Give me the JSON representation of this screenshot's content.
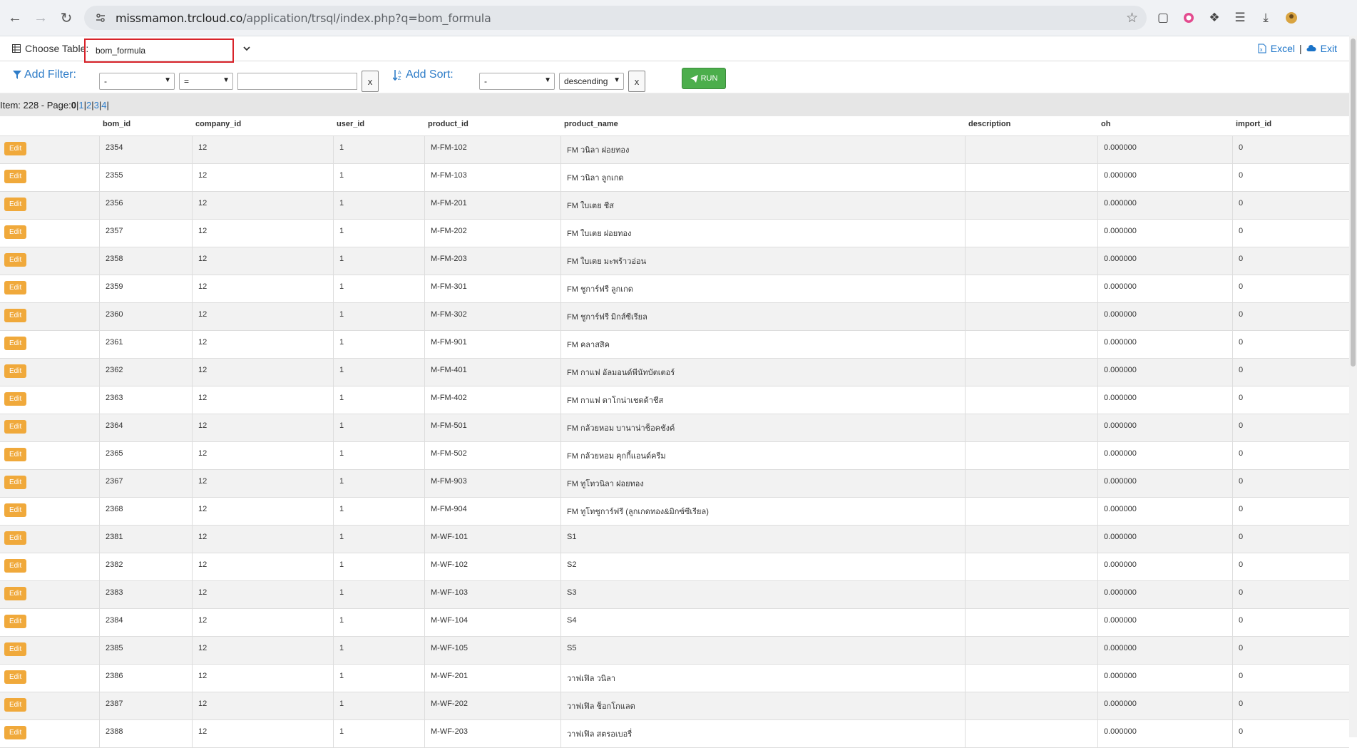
{
  "browser": {
    "url_host": "missmamon.trcloud.co",
    "url_path": "/application/trsql/index.php?q=bom_formula"
  },
  "toolbar": {
    "choose_table_label": "Choose Table:",
    "selected_table": "bom_formula",
    "excel_label": "Excel",
    "separator": "|",
    "exit_label": "Exit"
  },
  "filter": {
    "add_filter_label": "Add Filter:",
    "field_value": "-",
    "operator_value": "=",
    "clear_label": "x",
    "add_sort_label": "Add Sort:",
    "sort_field_value": "-",
    "sort_order_value": "descending",
    "sort_clear_label": "x",
    "run_label": "RUN"
  },
  "pager": {
    "prefix": "Item: 228 - Page:",
    "current": "0",
    "sep": " | ",
    "pages": [
      "1",
      "2",
      "3",
      "4"
    ]
  },
  "table": {
    "columns": [
      "",
      "bom_id",
      "company_id",
      "user_id",
      "product_id",
      "product_name",
      "description",
      "oh",
      "import_id"
    ],
    "edit_label": "Edit",
    "rows": [
      [
        "2354",
        "12",
        "1",
        "M-FM-102",
        "FM วนิลา ฝอยทอง",
        "",
        "0.000000",
        "0"
      ],
      [
        "2355",
        "12",
        "1",
        "M-FM-103",
        "FM วนิลา ลูกเกด",
        "",
        "0.000000",
        "0"
      ],
      [
        "2356",
        "12",
        "1",
        "M-FM-201",
        "FM ใบเตย ชีส",
        "",
        "0.000000",
        "0"
      ],
      [
        "2357",
        "12",
        "1",
        "M-FM-202",
        "FM ใบเตย ฝอยทอง",
        "",
        "0.000000",
        "0"
      ],
      [
        "2358",
        "12",
        "1",
        "M-FM-203",
        "FM ใบเตย มะพร้าวอ่อน",
        "",
        "0.000000",
        "0"
      ],
      [
        "2359",
        "12",
        "1",
        "M-FM-301",
        "FM ชูการ์ฟรี ลูกเกด",
        "",
        "0.000000",
        "0"
      ],
      [
        "2360",
        "12",
        "1",
        "M-FM-302",
        "FM ชูการ์ฟรี มิกส์ซีเรียล",
        "",
        "0.000000",
        "0"
      ],
      [
        "2361",
        "12",
        "1",
        "M-FM-901",
        "FM คลาสสิค",
        "",
        "0.000000",
        "0"
      ],
      [
        "2362",
        "12",
        "1",
        "M-FM-401",
        "FM กาแฟ อัลมอนด์พีนัทบัตเตอร์",
        "",
        "0.000000",
        "0"
      ],
      [
        "2363",
        "12",
        "1",
        "M-FM-402",
        "FM กาแฟ ดาโกน่าเชดด้าชีส",
        "",
        "0.000000",
        "0"
      ],
      [
        "2364",
        "12",
        "1",
        "M-FM-501",
        "FM กล้วยหอม บานาน่าช็อคชังค์",
        "",
        "0.000000",
        "0"
      ],
      [
        "2365",
        "12",
        "1",
        "M-FM-502",
        "FM กล้วยหอม คุกกี้แอนด์ครีม",
        "",
        "0.000000",
        "0"
      ],
      [
        "2367",
        "12",
        "1",
        "M-FM-903",
        "FM ทูโทวนิลา ฝอยทอง",
        "",
        "0.000000",
        "0"
      ],
      [
        "2368",
        "12",
        "1",
        "M-FM-904",
        "FM ทูโทชูการ์ฟรี (ลูกเกดทอง&มิกซ์ซีเรียล)",
        "",
        "0.000000",
        "0"
      ],
      [
        "2381",
        "12",
        "1",
        "M-WF-101",
        "S1",
        "",
        "0.000000",
        "0"
      ],
      [
        "2382",
        "12",
        "1",
        "M-WF-102",
        "S2",
        "",
        "0.000000",
        "0"
      ],
      [
        "2383",
        "12",
        "1",
        "M-WF-103",
        "S3",
        "",
        "0.000000",
        "0"
      ],
      [
        "2384",
        "12",
        "1",
        "M-WF-104",
        "S4",
        "",
        "0.000000",
        "0"
      ],
      [
        "2385",
        "12",
        "1",
        "M-WF-105",
        "S5",
        "",
        "0.000000",
        "0"
      ],
      [
        "2386",
        "12",
        "1",
        "M-WF-201",
        "วาฟเฟิล วนิลา",
        "",
        "0.000000",
        "0"
      ],
      [
        "2387",
        "12",
        "1",
        "M-WF-202",
        "วาฟเฟิล ช็อกโกแลต",
        "",
        "0.000000",
        "0"
      ],
      [
        "2388",
        "12",
        "1",
        "M-WF-203",
        "วาฟเฟิล สตรอเบอรี่",
        "",
        "0.000000",
        "0"
      ]
    ]
  },
  "colors": {
    "accent": "#2f7dc8",
    "run_button": "#4cae4c",
    "edit_button": "#f0a93b",
    "highlight_border": "#d8232a"
  }
}
